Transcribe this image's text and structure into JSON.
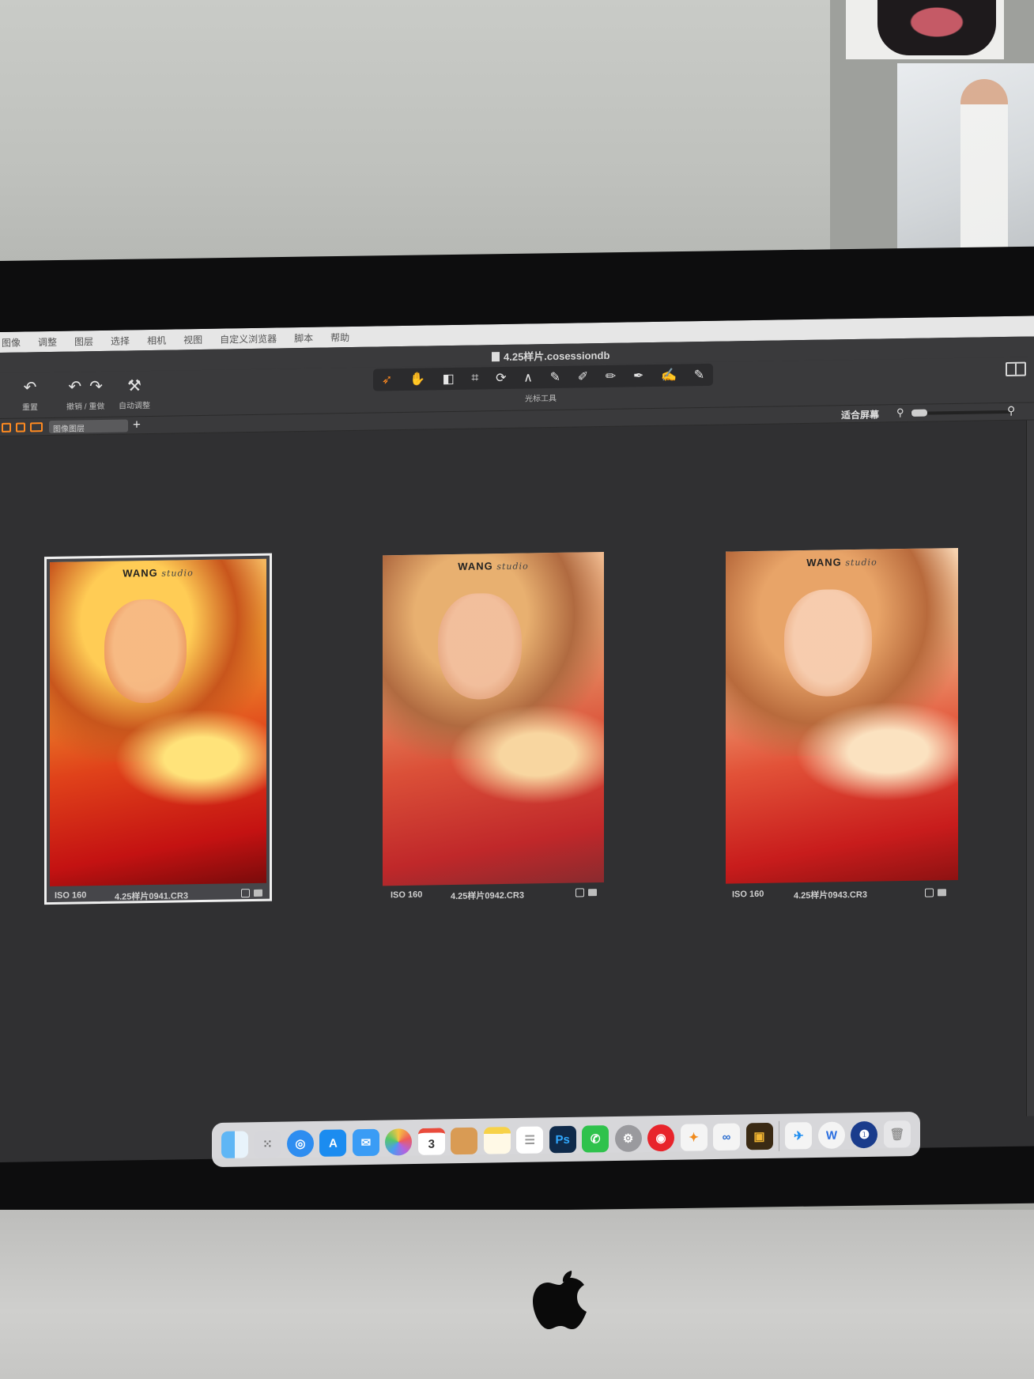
{
  "menubar": {
    "items": [
      "图像",
      "调整",
      "图层",
      "选择",
      "相机",
      "视图",
      "自定义浏览器",
      "脚本",
      "帮助"
    ]
  },
  "window": {
    "title": "4.25样片.cosessiondb"
  },
  "toolbar": {
    "reset_label": "重置",
    "undo_redo_label": "撤销 / 重做",
    "auto_adjust_label": "自动调整",
    "cursor_tools_label": "光标工具"
  },
  "viewer": {
    "stack_select": "图像图层",
    "fit_label": "适合屏幕"
  },
  "thumbnails": [
    {
      "iso": "ISO 160",
      "filename": "4.25样片0941.CR3",
      "selected": true,
      "brand": "WANG",
      "brand_script": "studio"
    },
    {
      "iso": "ISO 160",
      "filename": "4.25样片0942.CR3",
      "selected": false,
      "brand": "WANG",
      "brand_script": "studio"
    },
    {
      "iso": "ISO 160",
      "filename": "4.25样片0943.CR3",
      "selected": false,
      "brand": "WANG",
      "brand_script": "studio"
    }
  ],
  "dock": {
    "icons": [
      "finder-icon",
      "launchpad-icon",
      "safari-icon",
      "app-store-icon",
      "mail-icon",
      "photos-icon",
      "calendar-icon",
      "folder-icon",
      "notes-icon",
      "reminders-icon",
      "photoshop-icon",
      "wechat-icon",
      "system-preferences-icon",
      "netease-music-icon",
      "app-icon",
      "capture-one-icon",
      "preview-icon",
      "lark-icon",
      "word-icon",
      "onepassword-icon",
      "trash-icon"
    ],
    "calendar_day": "3",
    "photoshop_text": "Ps",
    "word_text": "W"
  },
  "colors": {
    "accent": "#ff8a20",
    "viewer_bg": "#303032"
  }
}
